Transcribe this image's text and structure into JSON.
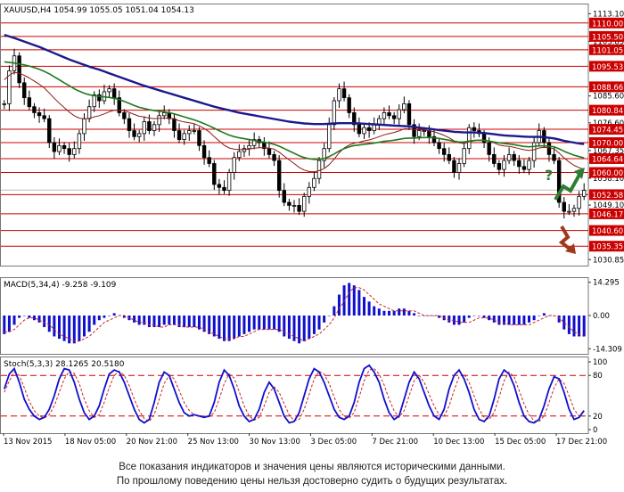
{
  "chart_data": {
    "type": "candlestick",
    "symbol_header": "XAUUSD,H4  1054.99 1055.05 1051.04 1054.13",
    "price_panel": {
      "ylim": [
        1028.85,
        1116.5
      ],
      "tick_labels": [
        1113.1,
        1103.85,
        1085.6,
        1076.6,
        1067.35,
        1058.1,
        1049.1,
        1030.85
      ],
      "levels": [
        1110.0,
        1105.5,
        1101.05,
        1095.53,
        1088.66,
        1080.84,
        1074.45,
        1070.0,
        1064.64,
        1060.0,
        1052.58,
        1046.17,
        1040.6,
        1035.35
      ],
      "level_labels": [
        "1110.00",
        "1105.50",
        "1101.05",
        "1095.53",
        "1088.66",
        "1080.84",
        "1074.45",
        "1070.00",
        "1064.64",
        "1060.00",
        "1052.58",
        "1046.17",
        "1040.60",
        "1035.35"
      ],
      "level_color": "#cc0000",
      "current_price": 1054.13,
      "ma_colors": {
        "slow": "#1a1a8c",
        "mid": "#1e7a1e",
        "fast": "#8b1a1a"
      },
      "up_arrow_color": "#2e7d32",
      "down_arrow_color": "#a0391c",
      "question_mark": "?",
      "close": [
        1083,
        1094,
        1099,
        1090,
        1085,
        1082,
        1080,
        1079,
        1078,
        1070,
        1067,
        1069,
        1068,
        1066,
        1068,
        1073,
        1078,
        1082,
        1086,
        1084,
        1087,
        1088,
        1085,
        1080,
        1078,
        1074,
        1072,
        1073,
        1077,
        1074,
        1076,
        1079,
        1080,
        1078,
        1074,
        1071,
        1073,
        1074,
        1074,
        1069,
        1065,
        1063,
        1056,
        1055,
        1054,
        1060,
        1065,
        1067,
        1068,
        1069,
        1071,
        1070,
        1068,
        1066,
        1064,
        1054,
        1050,
        1049,
        1049,
        1047,
        1052,
        1055,
        1058,
        1064,
        1068,
        1076,
        1084,
        1088,
        1085,
        1080,
        1076,
        1073,
        1075,
        1074,
        1076,
        1078,
        1080,
        1079,
        1078,
        1081,
        1083,
        1076,
        1072,
        1074,
        1074,
        1072,
        1070,
        1068,
        1066,
        1064,
        1060,
        1063,
        1068,
        1075,
        1074,
        1073,
        1070,
        1066,
        1063,
        1061,
        1064,
        1066,
        1064,
        1062,
        1061,
        1064,
        1070,
        1074,
        1070,
        1066,
        1064,
        1050,
        1047,
        1047,
        1048,
        1052,
        1054
      ],
      "ma_slow": [
        1106,
        1105.5,
        1105,
        1104.4,
        1103.8,
        1103.2,
        1102.6,
        1102,
        1101.3,
        1100.6,
        1099.9,
        1099.2,
        1098.5,
        1097.8,
        1097.2,
        1096.6,
        1096,
        1095.4,
        1094.9,
        1094.4,
        1093.8,
        1093.2,
        1092.6,
        1092,
        1091.4,
        1090.8,
        1090.2,
        1089.6,
        1089,
        1088.5,
        1088,
        1087.5,
        1087,
        1086.5,
        1086,
        1085.5,
        1085,
        1084.5,
        1084,
        1083.5,
        1083,
        1082.5,
        1082,
        1081.6,
        1081.2,
        1080.8,
        1080.4,
        1080,
        1079.7,
        1079.4,
        1079.1,
        1078.8,
        1078.5,
        1078.2,
        1077.9,
        1077.6,
        1077.3,
        1077,
        1076.8,
        1076.6,
        1076.4,
        1076.3,
        1076.2,
        1076.2,
        1076.2,
        1076.3,
        1076.4,
        1076.5,
        1076.5,
        1076.5,
        1076.5,
        1076.4,
        1076.3,
        1076.2,
        1076.1,
        1076,
        1075.9,
        1075.8,
        1075.7,
        1075.6,
        1075.5,
        1075.4,
        1075.2,
        1075,
        1074.8,
        1074.6,
        1074.4,
        1074.2,
        1074,
        1073.8,
        1073.6,
        1073.5,
        1073.4,
        1073.4,
        1073.4,
        1073.3,
        1073.2,
        1073,
        1072.8,
        1072.6,
        1072.4,
        1072.3,
        1072.2,
        1072.1,
        1072,
        1071.9,
        1071.9,
        1071.9,
        1071.8,
        1071.6,
        1071.4,
        1071,
        1070.6,
        1070.3,
        1070,
        1069.7,
        1069.5
      ],
      "ma_mid": [
        1097,
        1096.8,
        1096.6,
        1096.3,
        1096,
        1095.6,
        1095.1,
        1094.5,
        1093.8,
        1093,
        1092,
        1091,
        1090,
        1089,
        1088,
        1087.2,
        1086.5,
        1086,
        1085.7,
        1085.5,
        1085.3,
        1085.1,
        1084.8,
        1084.4,
        1083.8,
        1083.1,
        1082.4,
        1081.8,
        1081.4,
        1081,
        1080.7,
        1080.5,
        1080.3,
        1080,
        1079.6,
        1079.1,
        1078.6,
        1078.1,
        1077.6,
        1077,
        1076.3,
        1075.6,
        1074.8,
        1074,
        1073.2,
        1072.5,
        1072,
        1071.6,
        1071.3,
        1071,
        1070.7,
        1070.4,
        1070.1,
        1069.8,
        1069.4,
        1068.8,
        1068,
        1067.2,
        1066.4,
        1065.6,
        1065,
        1064.6,
        1064.4,
        1064.4,
        1064.7,
        1065.3,
        1066.2,
        1067.2,
        1068,
        1068.6,
        1069,
        1069.2,
        1069.4,
        1069.6,
        1069.8,
        1070.1,
        1070.4,
        1070.6,
        1070.8,
        1071.1,
        1071.4,
        1071.5,
        1071.5,
        1071.6,
        1071.7,
        1071.7,
        1071.6,
        1071.4,
        1071.1,
        1070.8,
        1070.4,
        1070.2,
        1070.2,
        1070.5,
        1070.7,
        1070.8,
        1070.7,
        1070.5,
        1070.2,
        1069.9,
        1069.7,
        1069.5,
        1069.3,
        1069,
        1068.7,
        1068.6,
        1068.7,
        1068.9,
        1068.9,
        1068.8,
        1068.6,
        1067.9,
        1067.1,
        1066.4,
        1065.8,
        1065.3,
        1064.9
      ],
      "ma_fast": [
        1091,
        1092.5,
        1093.5,
        1093.2,
        1092.5,
        1091.6,
        1090.6,
        1089.5,
        1088.3,
        1086.6,
        1084.8,
        1083.2,
        1081.7,
        1080.2,
        1079,
        1078.2,
        1077.9,
        1078.1,
        1078.6,
        1079,
        1079.6,
        1080.3,
        1080.8,
        1080.8,
        1080.6,
        1080.1,
        1079.4,
        1078.8,
        1078.6,
        1078.2,
        1078,
        1078.1,
        1078.2,
        1078.2,
        1077.9,
        1077.3,
        1076.9,
        1076.6,
        1076.3,
        1075.6,
        1074.7,
        1073.6,
        1072,
        1070.5,
        1069.1,
        1068.2,
        1067.8,
        1067.7,
        1067.7,
        1067.8,
        1068.1,
        1068.3,
        1068.3,
        1068.1,
        1067.8,
        1066.8,
        1065.5,
        1064.2,
        1063,
        1061.7,
        1060.8,
        1060.3,
        1060.2,
        1060.6,
        1061.3,
        1062.6,
        1064.5,
        1066.6,
        1068.2,
        1069.2,
        1069.8,
        1070.1,
        1070.6,
        1070.9,
        1071.4,
        1072,
        1072.6,
        1073,
        1073.4,
        1073.9,
        1074.6,
        1074.6,
        1074.4,
        1074.3,
        1074.2,
        1074,
        1073.6,
        1073.1,
        1072.4,
        1071.6,
        1070.6,
        1069.9,
        1069.7,
        1070.2,
        1070.6,
        1070.9,
        1070.8,
        1070.5,
        1069.9,
        1069.2,
        1068.9,
        1068.7,
        1068.4,
        1068,
        1067.6,
        1067.4,
        1067.6,
        1068.2,
        1068.4,
        1068.3,
        1067.9,
        1066.5,
        1064.9,
        1063.5,
        1062.4,
        1061.6,
        1061.1
      ]
    },
    "macd_panel": {
      "header": "MACD(5,34,4) -9.258 -9.109",
      "ylim": [
        -16.5,
        16.5
      ],
      "tick_labels": [
        "14.295",
        "0.00",
        "-14.309"
      ],
      "bar_color": "#1010cc",
      "signal_color": "#cc2222",
      "histogram": [
        -8,
        -7,
        -4,
        -1,
        0,
        -1,
        -2,
        -3,
        -5,
        -7,
        -9,
        -10,
        -11,
        -12,
        -12,
        -11,
        -9,
        -7,
        -4,
        -2,
        -1,
        0,
        1,
        0,
        -1,
        -2,
        -3,
        -4,
        -4,
        -5,
        -5,
        -5,
        -4,
        -4,
        -4,
        -5,
        -5,
        -5,
        -5,
        -6,
        -7,
        -8,
        -9,
        -10,
        -11,
        -11,
        -10,
        -9,
        -8,
        -7,
        -6,
        -6,
        -6,
        -6,
        -6,
        -7,
        -9,
        -10,
        -11,
        -12,
        -11,
        -10,
        -8,
        -6,
        -3,
        0,
        4,
        9,
        13,
        14,
        13,
        11,
        8,
        6,
        4,
        3,
        2,
        2,
        2,
        3,
        3,
        2,
        1,
        0,
        0,
        0,
        0,
        -1,
        -2,
        -3,
        -4,
        -4,
        -3,
        -1,
        0,
        0,
        -1,
        -2,
        -3,
        -4,
        -4,
        -4,
        -4,
        -4,
        -4,
        -3,
        -2,
        0,
        1,
        0,
        0,
        -3,
        -6,
        -8,
        -9,
        -9,
        -9
      ],
      "signal": [
        -7,
        -7,
        -6,
        -4,
        -2,
        -1,
        -1,
        -2,
        -3,
        -4,
        -6,
        -8,
        -9,
        -10,
        -11,
        -11,
        -10,
        -9,
        -7,
        -5,
        -3,
        -2,
        -1,
        0,
        0,
        -1,
        -2,
        -3,
        -3,
        -4,
        -4,
        -5,
        -5,
        -4,
        -4,
        -4,
        -5,
        -5,
        -5,
        -5,
        -6,
        -7,
        -8,
        -9,
        -10,
        -10,
        -10,
        -9,
        -9,
        -8,
        -7,
        -6,
        -6,
        -6,
        -6,
        -6,
        -7,
        -8,
        -9,
        -10,
        -11,
        -10,
        -9,
        -8,
        -6,
        -4,
        -1,
        3,
        6,
        10,
        12,
        12,
        11,
        9,
        7,
        5,
        4,
        3,
        2,
        2,
        2,
        2,
        2,
        1,
        0,
        0,
        0,
        0,
        -1,
        -2,
        -2,
        -3,
        -3,
        -3,
        -2,
        -1,
        -1,
        -1,
        -2,
        -3,
        -3,
        -4,
        -4,
        -4,
        -4,
        -4,
        -3,
        -2,
        -1,
        0,
        0,
        -1,
        -3,
        -5,
        -7,
        -8,
        -9
      ]
    },
    "stoch_panel": {
      "header": "Stoch(5,3,3) 28.1265 20.5180",
      "ylim": [
        0,
        100
      ],
      "tick_labels": [
        100,
        80,
        20,
        0
      ],
      "levels": [
        80,
        20
      ],
      "main_color": "#1010cc",
      "signal_color": "#cc2222",
      "main": [
        60,
        82,
        90,
        70,
        45,
        30,
        20,
        15,
        18,
        30,
        50,
        75,
        90,
        88,
        70,
        45,
        25,
        15,
        20,
        35,
        60,
        82,
        88,
        85,
        70,
        50,
        30,
        15,
        10,
        15,
        40,
        70,
        85,
        80,
        60,
        40,
        25,
        20,
        22,
        20,
        18,
        20,
        40,
        70,
        88,
        80,
        60,
        35,
        20,
        12,
        15,
        30,
        55,
        70,
        60,
        40,
        20,
        10,
        12,
        25,
        50,
        75,
        90,
        85,
        70,
        50,
        30,
        18,
        15,
        20,
        40,
        70,
        90,
        95,
        85,
        70,
        45,
        25,
        15,
        20,
        45,
        70,
        85,
        75,
        55,
        35,
        20,
        15,
        30,
        60,
        80,
        88,
        75,
        55,
        30,
        15,
        12,
        20,
        45,
        75,
        88,
        82,
        65,
        40,
        20,
        12,
        10,
        15,
        35,
        60,
        78,
        75,
        55,
        30,
        15,
        18,
        28
      ],
      "signal": [
        55,
        72,
        85,
        80,
        62,
        42,
        28,
        20,
        17,
        22,
        35,
        55,
        75,
        86,
        83,
        68,
        45,
        28,
        18,
        22,
        40,
        62,
        80,
        86,
        80,
        65,
        45,
        28,
        16,
        12,
        22,
        45,
        68,
        80,
        75,
        58,
        40,
        28,
        22,
        20,
        20,
        19,
        25,
        45,
        68,
        82,
        76,
        56,
        35,
        20,
        14,
        18,
        35,
        55,
        63,
        55,
        38,
        22,
        13,
        15,
        30,
        52,
        75,
        86,
        82,
        68,
        48,
        30,
        19,
        17,
        25,
        48,
        72,
        88,
        90,
        82,
        66,
        45,
        28,
        18,
        28,
        50,
        72,
        80,
        70,
        52,
        35,
        22,
        20,
        35,
        58,
        78,
        82,
        70,
        50,
        30,
        18,
        15,
        25,
        48,
        72,
        85,
        78,
        58,
        38,
        22,
        13,
        12,
        20,
        40,
        62,
        75,
        68,
        50,
        30,
        20,
        20
      ]
    },
    "x_labels": [
      "13 Nov 2015",
      "18 Nov 05:00",
      "20 Nov 21:00",
      "25 Nov 13:00",
      "30 Nov 13:00",
      "3 Dec 05:00",
      "7 Dec 21:00",
      "10 Dec 13:00",
      "15 Dec 05:00",
      "17 Dec 21:00"
    ]
  },
  "disclaimer": {
    "line1": "Все показания индикаторов и значения цены являются историческими данными.",
    "line2": "По прошлому поведению цены нельзя достоверно судить о будущих результатах."
  }
}
